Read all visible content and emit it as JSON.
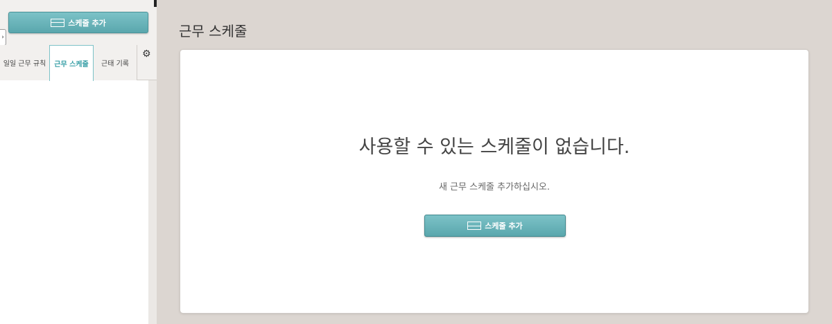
{
  "sidebar": {
    "add_button_label": "스케줄 추가",
    "collapse_glyph": "›",
    "tabs": [
      {
        "label": "일일 근무 규칙"
      },
      {
        "label": "근무 스케줄"
      },
      {
        "label": "근태 기록"
      }
    ],
    "gear_glyph": "⚙"
  },
  "main": {
    "title": "근무 스케줄",
    "empty_title": "사용할 수 있는 스케줄이 없습니다.",
    "empty_subtitle": "새 근무 스케줄 추가하십시오.",
    "add_button_label": "스케줄 추가"
  },
  "colors": {
    "accent": "#5aa7ad",
    "background": "#dcd6d1"
  }
}
